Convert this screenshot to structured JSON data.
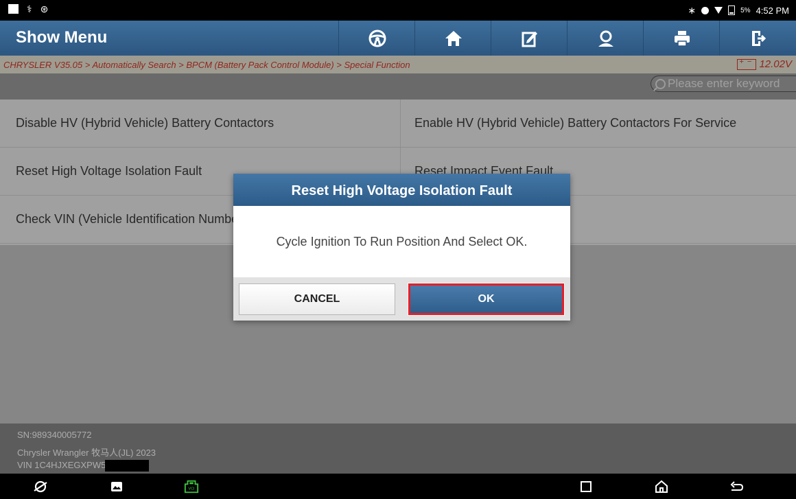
{
  "status_bar": {
    "battery_pct": "5%",
    "time": "4:52 PM"
  },
  "header": {
    "title": "Show Menu",
    "toolbar": [
      "steering-wheel-icon",
      "home-icon",
      "edit-icon",
      "user-support-icon",
      "print-icon",
      "exit-icon"
    ]
  },
  "breadcrumb": {
    "path": "CHRYSLER V35.05 > Automatically Search > BPCM (Battery Pack Control Module) > Special Function",
    "voltage": "12.02V"
  },
  "search": {
    "placeholder": "Please enter keyword"
  },
  "menu": {
    "items": [
      "Disable HV (Hybrid Vehicle) Battery Contactors",
      "Enable HV (Hybrid Vehicle) Battery Contactors For Service",
      "Reset High Voltage Isolation Fault",
      "Reset Impact Event Fault",
      "Check VIN (Vehicle Identification Number)"
    ]
  },
  "footer": {
    "sn": "SN:989340005772",
    "vehicle": "Chrysler Wrangler 牧马人(JL) 2023",
    "vin": "VIN 1C4HJXEGXPW5"
  },
  "dialog": {
    "title": "Reset High Voltage Isolation Fault",
    "message": "Cycle Ignition To Run Position And Select OK.",
    "cancel_label": "CANCEL",
    "ok_label": "OK"
  },
  "colors": {
    "header_blue": "#2c5680",
    "breadcrumb_red": "#d9392a",
    "highlight_red": "#e3202a",
    "vci_green": "#3ec43e"
  }
}
